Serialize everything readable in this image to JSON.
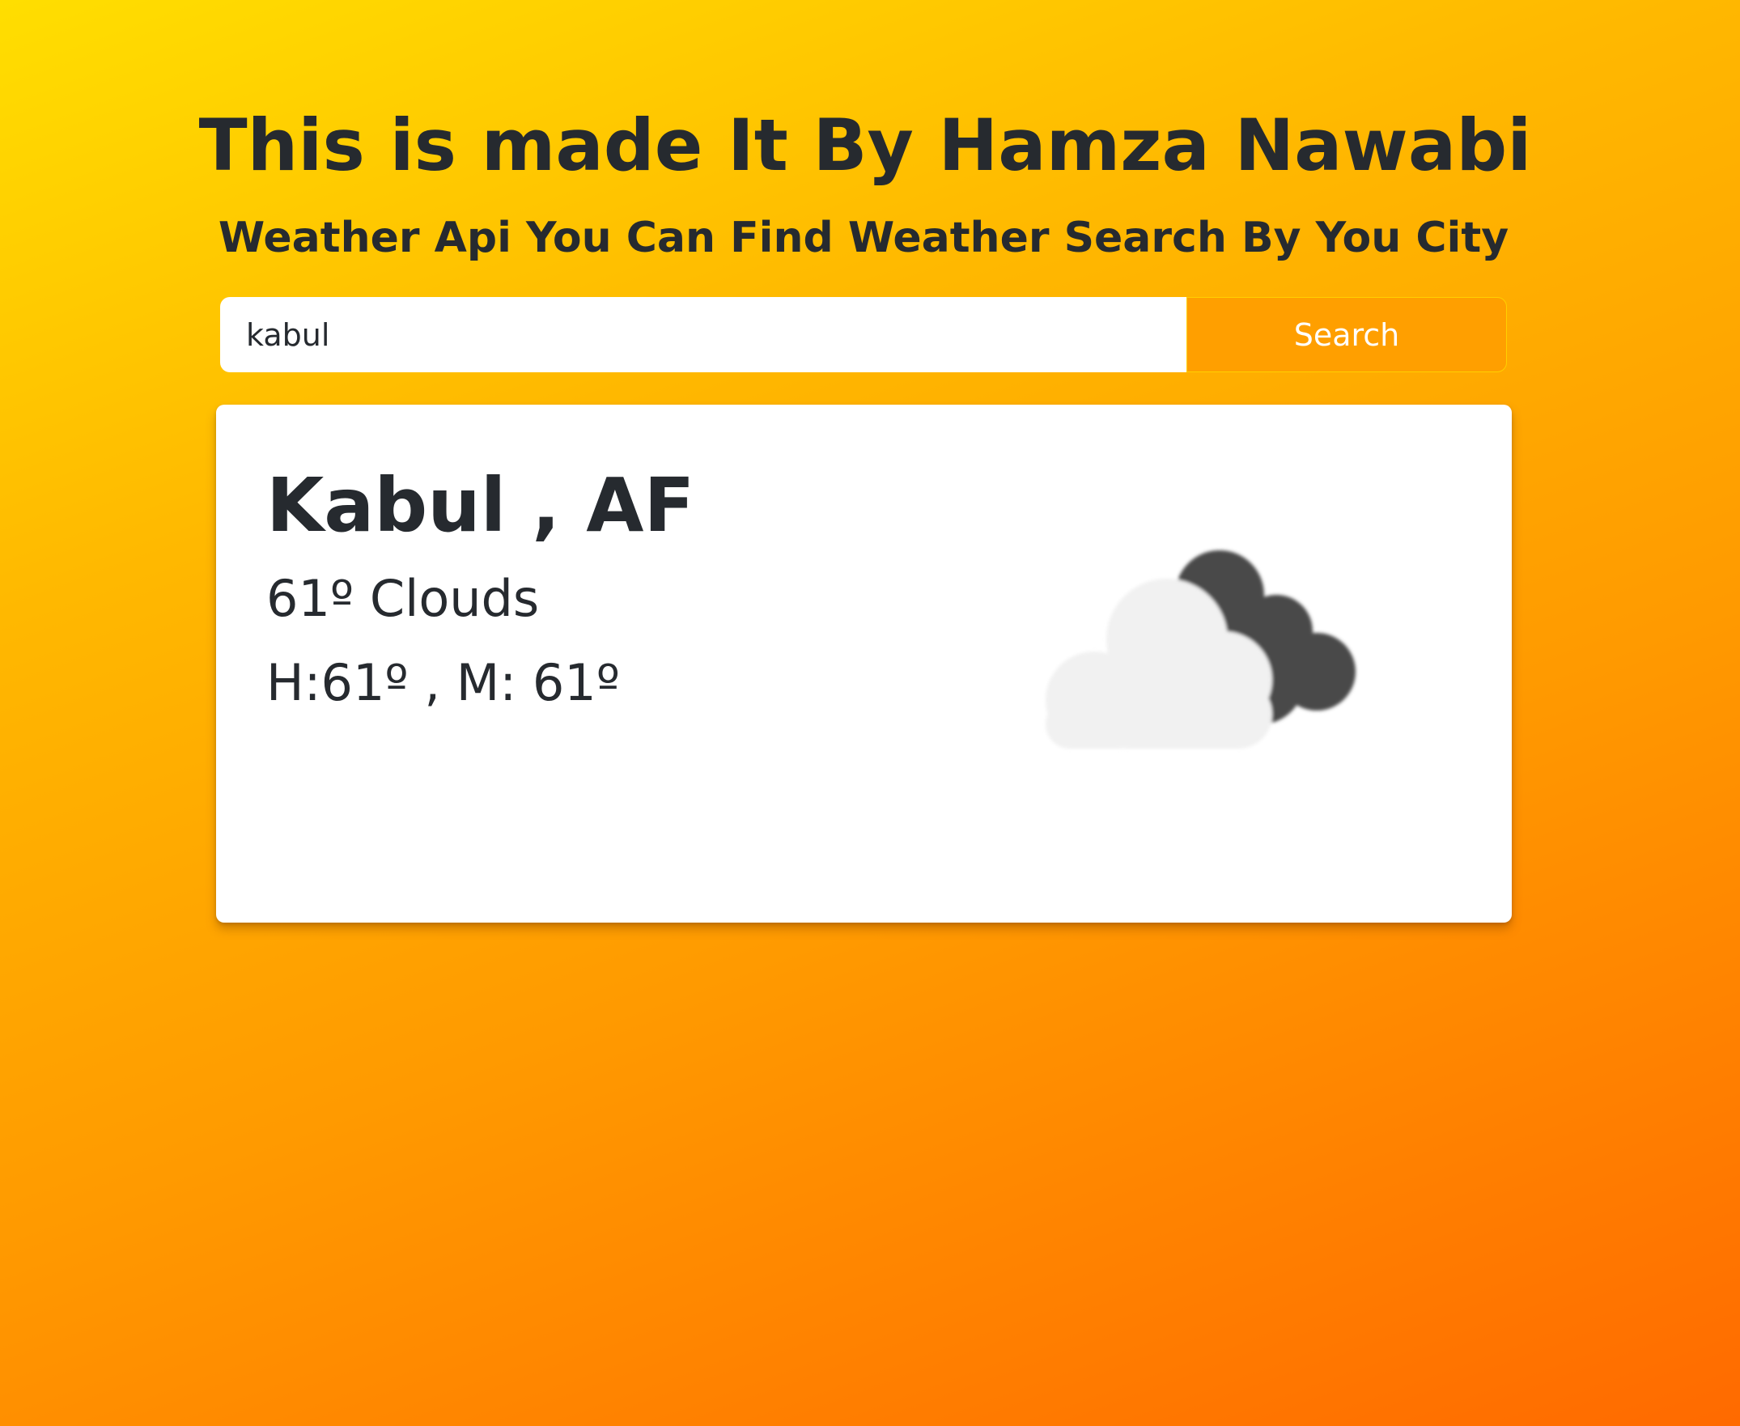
{
  "header": {
    "title": "This is made It By Hamza Nawabi",
    "subtitle": "Weather Api You Can Find Weather Search By You City"
  },
  "search": {
    "value": "kabul",
    "placeholder": "",
    "button_label": "Search"
  },
  "weather": {
    "location": "Kabul , AF",
    "temperature_line": "61º Clouds",
    "range_line": "H:61º , M: 61º",
    "icon": "cloudy-night-icon"
  },
  "colors": {
    "gradient_start": "#FFDE00",
    "gradient_end": "#FF6A00",
    "button_bg": "#FF9F00",
    "text": "#262A2F"
  }
}
